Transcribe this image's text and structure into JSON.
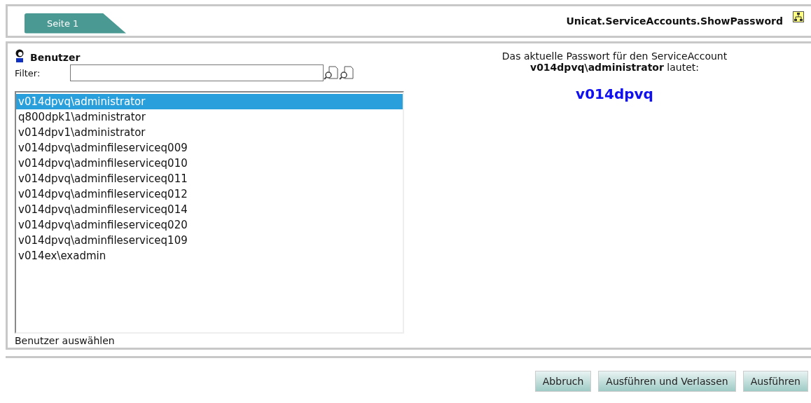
{
  "tabs": [
    {
      "label": "Seite 1",
      "selected": true
    }
  ],
  "window": {
    "title": "Unicat.ServiceAccounts.ShowPassword"
  },
  "users": {
    "title": "Benutzer",
    "filter": {
      "label": "Filter:"
    },
    "items": [
      {
        "label": "v014dpvq\\administrator",
        "selected": true
      },
      {
        "label": "q800dpk1\\administrator",
        "selected": false
      },
      {
        "label": "v014dpv1\\administrator",
        "selected": false
      },
      {
        "label": "v014dpvq\\adminfileserviceq009",
        "selected": false
      },
      {
        "label": "v014dpvq\\adminfileserviceq010",
        "selected": false
      },
      {
        "label": "v014dpvq\\adminfileserviceq011",
        "selected": false
      },
      {
        "label": "v014dpvq\\adminfileserviceq012",
        "selected": false
      },
      {
        "label": "v014dpvq\\adminfileserviceq014",
        "selected": false
      },
      {
        "label": "v014dpvq\\adminfileserviceq020",
        "selected": false
      },
      {
        "label": "v014dpvq\\adminfileserviceq109",
        "selected": false
      },
      {
        "label": "v014ex\\exadmin",
        "selected": false
      }
    ],
    "hint": "Benutzer auswählen"
  },
  "result": {
    "message": "Das aktuelle Passwort für den ServiceAccount **v014dpvq\\administrator** lautet:",
    "password": "v014dpvq"
  },
  "buttons": [
    "Abbruch",
    "Ausführen und Verlassen",
    "Ausführen"
  ]
}
